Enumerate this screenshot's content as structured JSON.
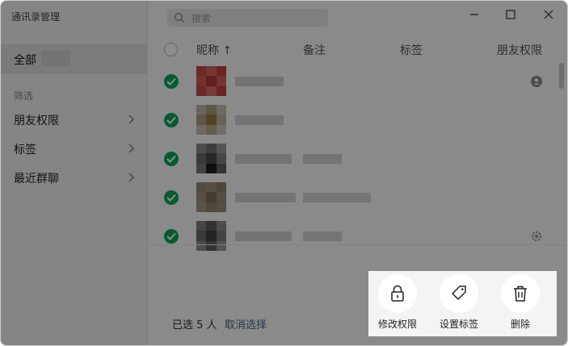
{
  "window": {
    "title": "通讯录管理"
  },
  "sidebar": {
    "all_label": "全部",
    "filter_label": "筛选",
    "items": [
      {
        "label": "朋友权限"
      },
      {
        "label": "标签"
      },
      {
        "label": "最近群聊"
      }
    ]
  },
  "search": {
    "placeholder": "搜索"
  },
  "table": {
    "headers": {
      "nickname": "昵称 ↑",
      "remark": "备注",
      "tags": "标签",
      "permission": "朋友权限"
    }
  },
  "footer": {
    "selected_text": "已选 5 人",
    "cancel_label": "取消选择"
  },
  "actions": [
    {
      "label": "修改权限",
      "icon": "lock-icon"
    },
    {
      "label": "设置标签",
      "icon": "tag-icon"
    },
    {
      "label": "删除",
      "icon": "trash-icon"
    }
  ],
  "colors": {
    "check_green": "#08a65b",
    "link_blue": "#4a6587"
  }
}
